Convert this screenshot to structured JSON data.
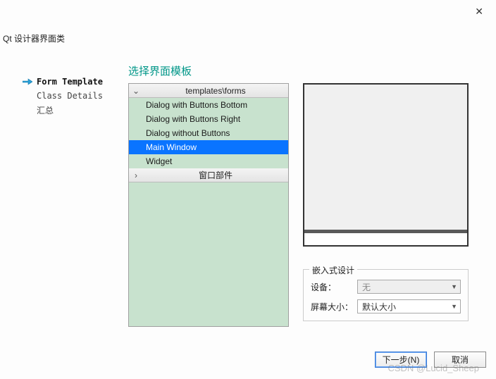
{
  "window": {
    "title": "Qt 设计器界面类"
  },
  "sidebar": {
    "items": [
      {
        "label": "Form Template",
        "active": true
      },
      {
        "label": "Class Details",
        "active": false
      },
      {
        "label": "汇总",
        "active": false
      }
    ]
  },
  "heading": "选择界面模板",
  "tree": {
    "groups": [
      {
        "label": "templates\\forms",
        "expanded": true,
        "items": [
          {
            "label": "Dialog with Buttons Bottom",
            "selected": false
          },
          {
            "label": "Dialog with Buttons Right",
            "selected": false
          },
          {
            "label": "Dialog without Buttons",
            "selected": false
          },
          {
            "label": "Main Window",
            "selected": true
          },
          {
            "label": "Widget",
            "selected": false
          }
        ]
      },
      {
        "label": "窗口部件",
        "expanded": false,
        "items": []
      }
    ]
  },
  "embed": {
    "legend": "嵌入式设计",
    "device_label": "设备：",
    "device_value": "无",
    "screen_label": "屏幕大小：",
    "screen_value": "默认大小"
  },
  "buttons": {
    "next": "下一步(N)",
    "cancel": "取消"
  },
  "watermark": "CSDN @Lucid_Sheep"
}
